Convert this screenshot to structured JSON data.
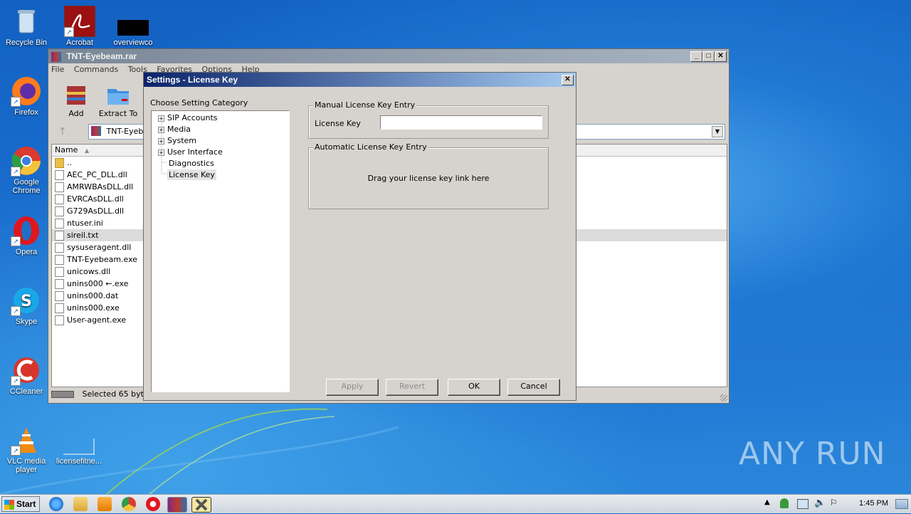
{
  "desktop": {
    "icons": [
      {
        "label": "Recycle Bin"
      },
      {
        "label": "Acrobat"
      },
      {
        "label": "overviewco"
      },
      {
        "label": "Firefox"
      },
      {
        "label": "Google Chrome"
      },
      {
        "label": "Opera"
      },
      {
        "label": "Skype"
      },
      {
        "label": "CCleaner"
      },
      {
        "label": "VLC media player"
      },
      {
        "label": "licensefitne..."
      }
    ],
    "watermark": "ANY RUN"
  },
  "winrar": {
    "title": "TNT-Eyebeam.rar",
    "menu": [
      "File",
      "Commands",
      "Tools",
      "Favorites",
      "Options",
      "Help"
    ],
    "toolbar": {
      "add": "Add",
      "extract": "Extract To"
    },
    "path": "TNT-Eyebe",
    "column_name": "Name",
    "files": [
      "..",
      "AEC_PC_DLL.dll",
      "AMRWBAsDLL.dll",
      "EVRCAsDLL.dll",
      "G729AsDLL.dll",
      "ntuser.ini",
      "sireil.txt",
      "sysuseragent.dll",
      "TNT-Eyebeam.exe",
      "unicows.dll",
      "unins000 ←.exe",
      "unins000.dat",
      "unins000.exe",
      "User-agent.exe"
    ],
    "selected_file": "sireil.txt",
    "status": "Selected 65 bytes"
  },
  "dialog": {
    "title": "Settings - License Key",
    "category_label": "Choose Setting Category",
    "tree": [
      {
        "label": "SIP Accounts",
        "expandable": true
      },
      {
        "label": "Media",
        "expandable": true
      },
      {
        "label": "System",
        "expandable": true
      },
      {
        "label": "User Interface",
        "expandable": true
      },
      {
        "label": "Diagnostics",
        "expandable": false
      },
      {
        "label": "License Key",
        "expandable": false,
        "selected": true
      }
    ],
    "manual_group": "Manual License Key Entry",
    "license_key_label": "License Key",
    "license_key_value": "",
    "auto_group": "Automatic License Key Entry",
    "drag_text": "Drag your license key link here",
    "buttons": {
      "apply": "Apply",
      "revert": "Revert",
      "ok": "OK",
      "cancel": "Cancel"
    }
  },
  "taskbar": {
    "start": "Start",
    "clock": "1:45 PM"
  }
}
